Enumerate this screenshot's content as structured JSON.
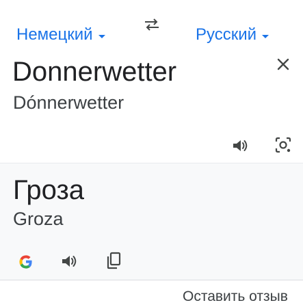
{
  "header": {
    "source_language": "Немецкий",
    "target_language": "Русский",
    "swap_icon": "swap-arrows-icon",
    "dropdown_icon": "caret-down-icon"
  },
  "source": {
    "text": "Donnerwetter",
    "transliteration": "Dónnerwetter",
    "close_icon": "close-icon",
    "speaker_icon": "speaker-icon",
    "lens_icon": "camera-lens-icon"
  },
  "result": {
    "text": "Гроза",
    "transliteration": "Groza",
    "google_icon": "google-g-icon",
    "speaker_icon": "speaker-icon",
    "copy_icon": "copy-icon"
  },
  "footer": {
    "feedback_label": "Оставить отзыв"
  },
  "colors": {
    "accent": "#1a73e8",
    "text_primary": "#202124",
    "text_secondary": "#3c4043",
    "icon": "#444746",
    "result_background": "#f8f9fa"
  }
}
